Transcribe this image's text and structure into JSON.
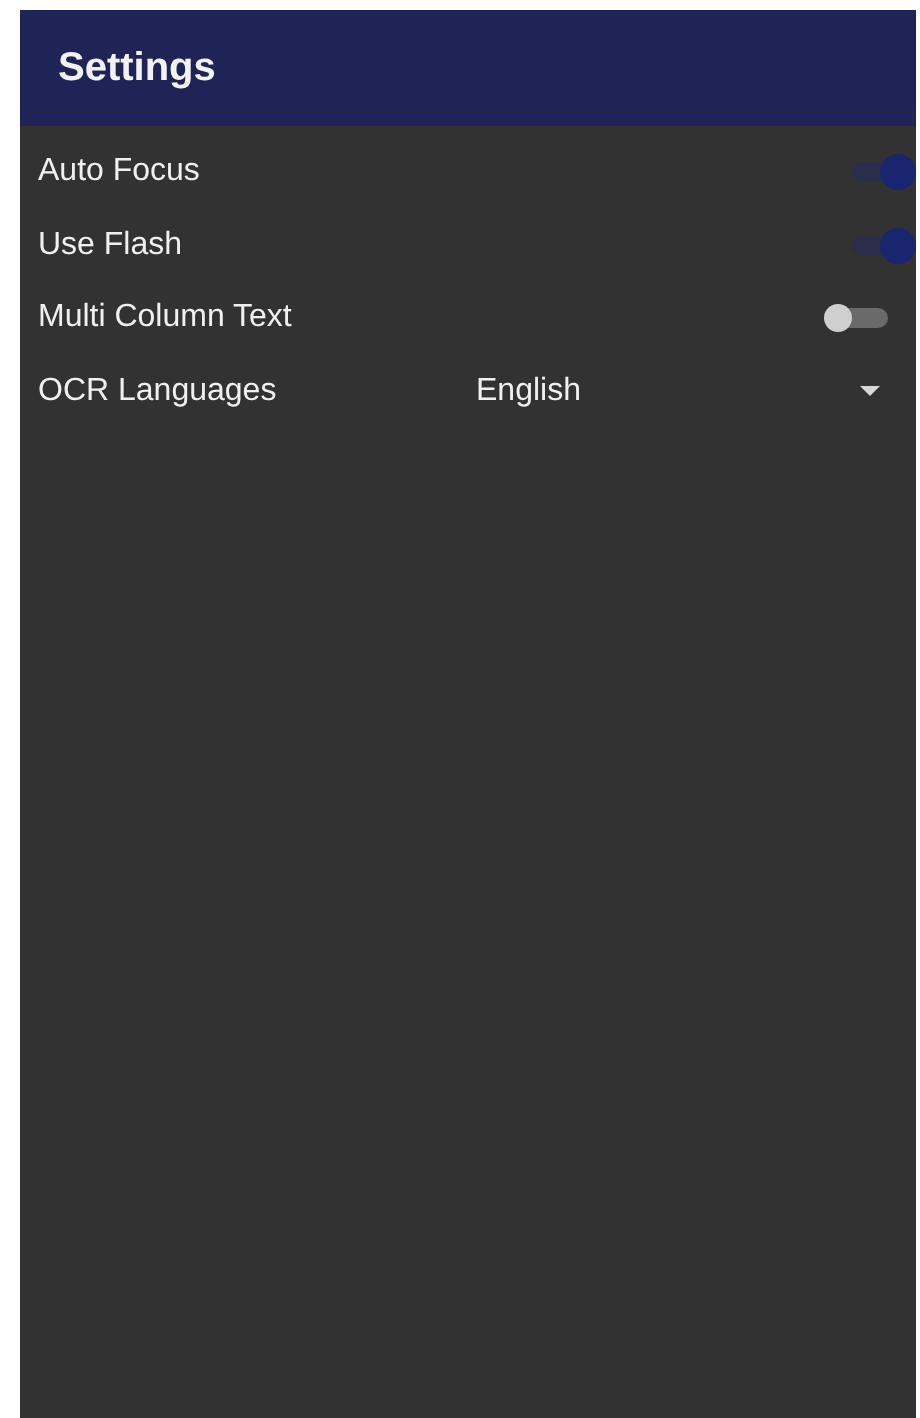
{
  "app_bar": {
    "title": "Settings"
  },
  "settings": [
    {
      "kind": "switch",
      "label": "Auto Focus",
      "on": true
    },
    {
      "kind": "switch",
      "label": "Use Flash",
      "on": true
    },
    {
      "kind": "switch",
      "label": "Multi Column Text",
      "on": false
    },
    {
      "kind": "dropdown",
      "label": "OCR Languages",
      "value": "English"
    }
  ]
}
